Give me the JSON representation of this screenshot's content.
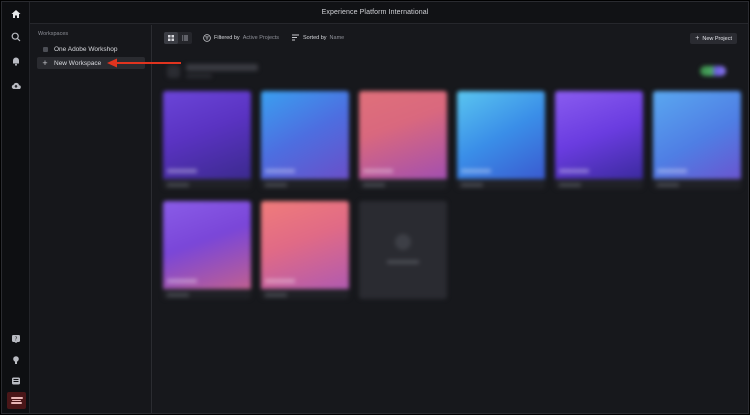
{
  "window": {
    "title": "Experience Platform International"
  },
  "rail": {
    "icons": [
      "home-icon",
      "search-icon",
      "bell-icon",
      "cloud-upload-icon",
      "help-icon",
      "lightbulb-icon",
      "apps-icon"
    ]
  },
  "sidebar": {
    "heading": "Workspaces",
    "items": [
      {
        "label": "One Adobe Workshop",
        "icon": "workspace-icon"
      },
      {
        "label": "New Workspace",
        "icon": "plus-icon"
      }
    ]
  },
  "toolbar": {
    "filter_label": "Filtered by",
    "filter_value": "Active Projects",
    "sort_label": "Sorted by",
    "sort_value": "Name",
    "new_project": "New Project"
  },
  "annotation": {
    "arrow_color": "#e0341f"
  },
  "projects": [
    {
      "gradient": "linear-gradient(160deg,#6b45d8 0%,#5a33c2 45%,#3b2a8e 100%)"
    },
    {
      "gradient": "linear-gradient(150deg,#3aa0f0 0%,#4d6ee0 50%,#6a4fc8 100%)"
    },
    {
      "gradient": "linear-gradient(160deg,#e0707a 0%,#d9687e 40%,#a24fb0 100%)"
    },
    {
      "gradient": "linear-gradient(150deg,#5ac6f0 0%,#3a8ee8 50%,#3a5ad0 100%)"
    },
    {
      "gradient": "linear-gradient(160deg,#8a5cf0 0%,#6a3ce0 50%,#3b2a9e 100%)"
    },
    {
      "gradient": "linear-gradient(150deg,#5aa8f0 0%,#4f7ee4 55%,#6a55d0 100%)"
    },
    {
      "gradient": "linear-gradient(160deg,#8a5ce8 0%,#7a46d8 45%,#c06090 100%)"
    },
    {
      "gradient": "linear-gradient(160deg,#f07c7a 0%,#e06a86 45%,#b05ab0 100%)"
    }
  ]
}
